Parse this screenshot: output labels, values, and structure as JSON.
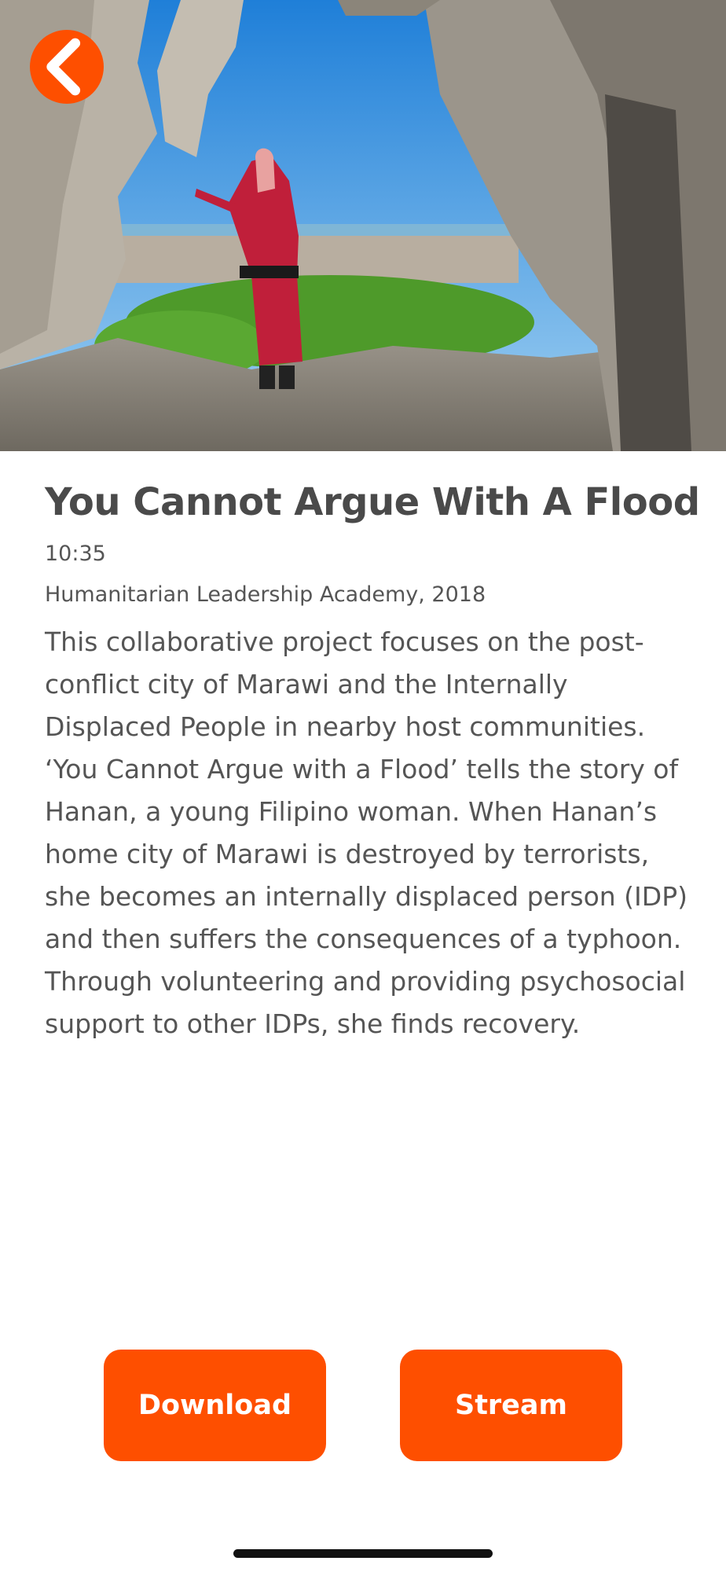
{
  "app": {
    "accent_color": "#fe4f00"
  },
  "header": {
    "back_icon": "chevron-left-icon"
  },
  "hero": {
    "image_subject": "photo",
    "colors": {
      "sky": "#2d8fe0",
      "rubble": "#8a8278",
      "robe": "#c01f3a",
      "foliage": "#4e9a2a"
    }
  },
  "film": {
    "title": "You Cannot Argue With A Flood",
    "duration": "10:35",
    "credit": "Humanitarian Leadership Academy, 2018",
    "description": "This collaborative project focuses on the post-conflict city of Marawi and the Internally Displaced People in nearby host communities. ‘You Cannot Argue with a Flood’ tells the story of Hanan, a young Filipino woman. When Hanan’s home city of Marawi is destroyed by terrorists, she becomes an internally displaced person (IDP) and then suffers the consequences of a typhoon. Through volunteering and providing psychosocial support to other IDPs, she finds recovery."
  },
  "actions": {
    "download_label": "Download",
    "stream_label": "Stream"
  }
}
